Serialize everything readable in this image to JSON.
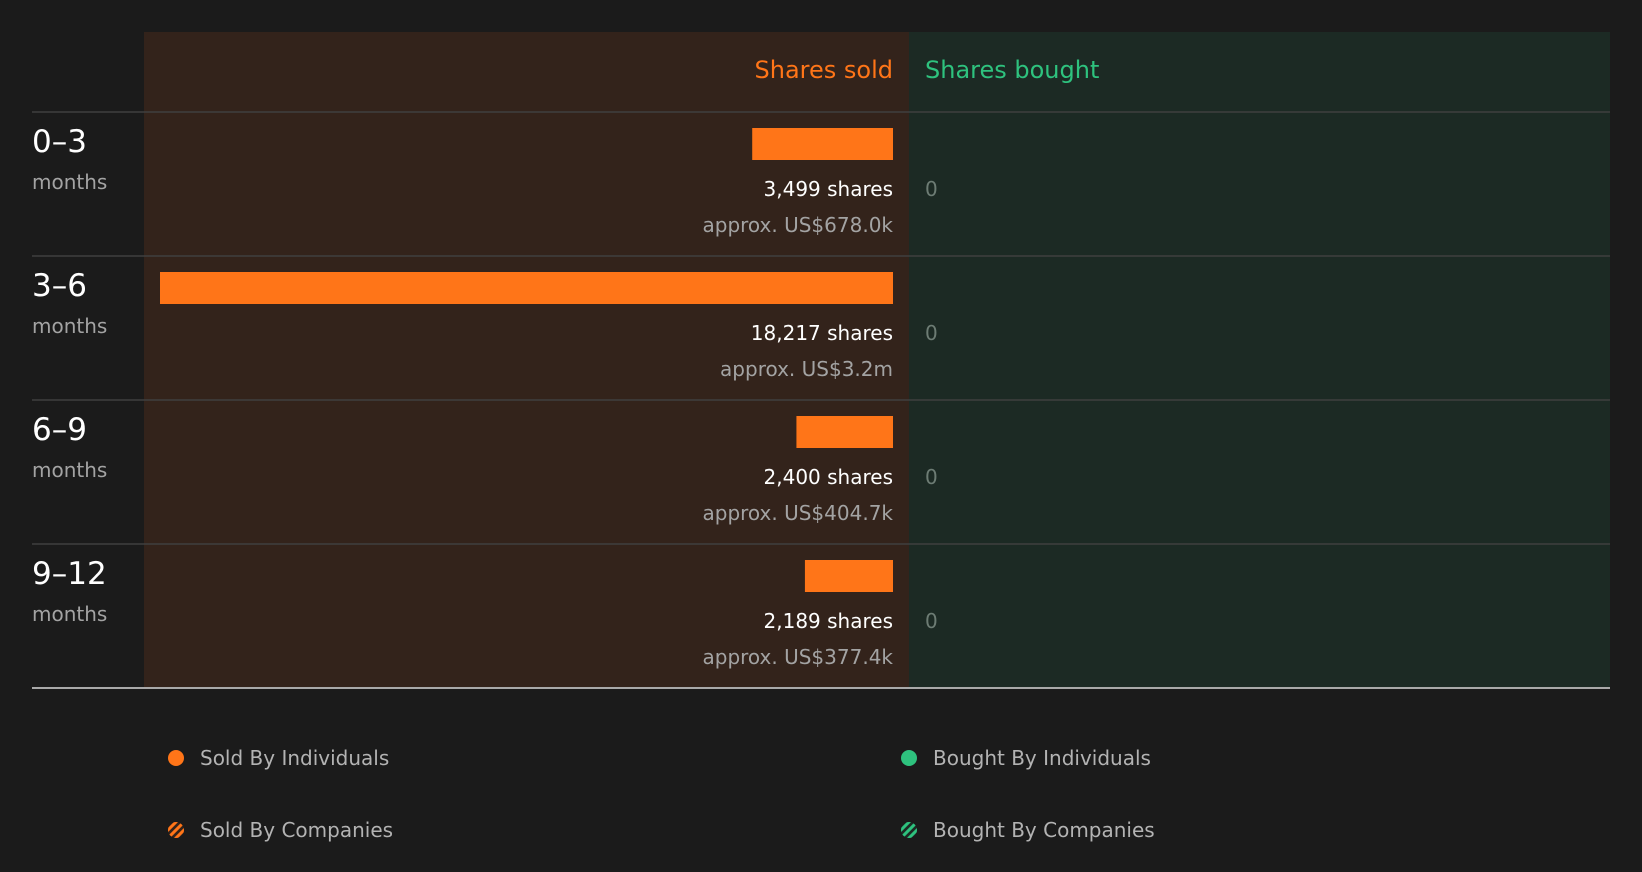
{
  "chart_data": {
    "type": "bar",
    "orientation": "horizontal-diverging",
    "column_headers": {
      "sold": "Shares sold",
      "bought": "Shares bought"
    },
    "unit_label": "months",
    "categories": [
      "0–3",
      "3–6",
      "6–9",
      "9–12"
    ],
    "series": [
      {
        "name": "Shares sold",
        "values": [
          3499,
          18217,
          2400,
          2189
        ],
        "value_labels": [
          "3,499 shares",
          "18,217 shares",
          "2,400 shares",
          "2,189 shares"
        ],
        "approx_labels": [
          "approx. US$678.0k",
          "approx. US$3.2m",
          "approx. US$404.7k",
          "approx. US$377.4k"
        ]
      },
      {
        "name": "Shares bought",
        "values": [
          0,
          0,
          0,
          0
        ],
        "value_labels": [
          "0",
          "0",
          "0",
          "0"
        ]
      }
    ],
    "xlim_sold": [
      0,
      18217
    ],
    "legend": {
      "placement": "bottom",
      "items": [
        {
          "label": "Sold By Individuals",
          "marker": "dot",
          "color": "#ff7518"
        },
        {
          "label": "Bought By Individuals",
          "marker": "dot",
          "color": "#2ec27e"
        },
        {
          "label": "Sold By Companies",
          "marker": "hatched",
          "color": "#ff7518"
        },
        {
          "label": "Bought By Companies",
          "marker": "hatched",
          "color": "#2ec27e"
        }
      ]
    }
  },
  "colors": {
    "background": "#1b1b1b",
    "sold_panel": "#33231b",
    "bought_panel": "#1c2a24",
    "sold_accent": "#ff7518",
    "bought_accent": "#2ec27e",
    "row_divider": "#3f3f3f",
    "bottom_rule": "#a9a9a9",
    "label_primary": "#ffffff",
    "label_secondary": "#a3a3a3",
    "zero_text": "#6d7c74"
  }
}
